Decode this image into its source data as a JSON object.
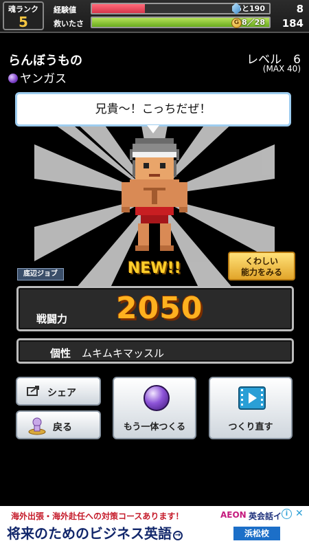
{
  "status": {
    "rank_label": "魂ランク",
    "rank_value": "5",
    "exp_label": "経験値",
    "exp_text": "あと190",
    "exp_fill": 0.3,
    "hp_label": "救いたさ",
    "hp_text": "28／28",
    "hp_fill": 1.0,
    "gems": "8",
    "coins": "184",
    "coin_glyph": "G"
  },
  "character": {
    "title": "らんぼうもの",
    "class_name": "ヤンガス",
    "level_label": "レベル　6",
    "level_max": "(MAX 40)",
    "speech": "兄貴〜！こっちだぜ！",
    "new_label": "NEW!!",
    "job_badge": "底辺ジョブ",
    "details_line1": "くわしい",
    "details_line2": "能力をみる"
  },
  "power": {
    "label": "戦闘力",
    "value": "2050"
  },
  "trait": {
    "label": "個性",
    "value": "ムキムキマッスル"
  },
  "actions": {
    "share": "シェア",
    "back": "戻る",
    "make_another": "もう一体つくる",
    "remake": "つくり直す"
  },
  "ad": {
    "line1": "海外出張・海外赴任への対策コースあります！",
    "line2": "将来のためのビジネス英語",
    "arrow": "→",
    "brand": "AEON",
    "tagline": "英会話イ",
    "school": "浜松校",
    "info": "i",
    "close": "✕"
  },
  "colors": {
    "power_gold": "#ffb11f",
    "exp_red": "#d7364a",
    "hp_green": "#6aab1e",
    "accent_blue": "#9ecdf0"
  }
}
